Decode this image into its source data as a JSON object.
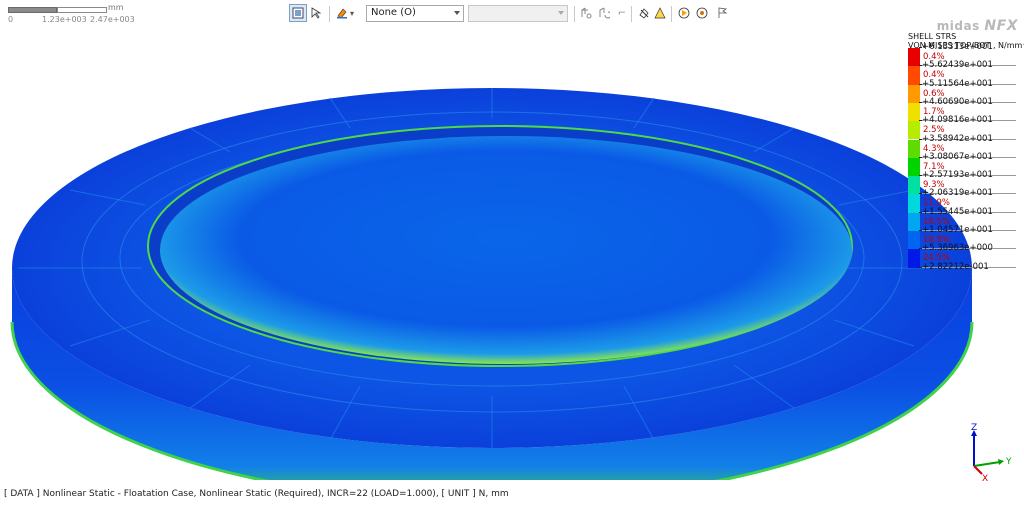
{
  "scale_bar": {
    "unit": "mm",
    "ticks": [
      "0",
      "1.23e+003",
      "2.47e+003"
    ]
  },
  "toolbar": {
    "load_case_value": "None (O)",
    "second_combo_value": "",
    "icons": [
      "display-icon",
      "select-icon",
      "paint-icon",
      "view-group-icon",
      "rotate-icon",
      "node-icon",
      "eraser-icon",
      "warning-icon",
      "play-icon",
      "settings-icon",
      "flag-icon"
    ]
  },
  "legend": {
    "brand_prefix": "midas",
    "brand_name": "NFX",
    "title_line1": "SHELL STRS",
    "title_line2": "VON MISES TOP/BOT , N/mm^",
    "values": [
      "+6.13313e+001",
      "+5.62439e+001",
      "+5.11564e+001",
      "+4.60690e+001",
      "+4.09816e+001",
      "+3.58942e+001",
      "+3.08067e+001",
      "+2.57193e+001",
      "+2.06319e+001",
      "+1.55445e+001",
      "+1.04571e+001",
      "+5.36963e+000",
      "+2.82212e-001"
    ],
    "percentages": [
      "0.4%",
      "0.4%",
      "0.6%",
      "1.7%",
      "2.5%",
      "4.3%",
      "7.1%",
      "9.3%",
      "11.9%",
      "18.5%",
      "18.8%",
      "24.5%"
    ],
    "colors": [
      "#e60000",
      "#ff4a00",
      "#ff9a00",
      "#f0e000",
      "#b6ec00",
      "#5cdc00",
      "#00d400",
      "#00e0a0",
      "#00d8dc",
      "#00a6f0",
      "#0066f0",
      "#0018e8"
    ]
  },
  "axis_triad": {
    "z_label": "Z",
    "y_label": "Y",
    "x_label": "X"
  },
  "status": {
    "text": "[ DATA ]  Nonlinear Static - Floatation Case,  Nonlinear Static (Required),  INCR=22 (LOAD=1.000),   [ UNIT ]   N,  mm"
  }
}
